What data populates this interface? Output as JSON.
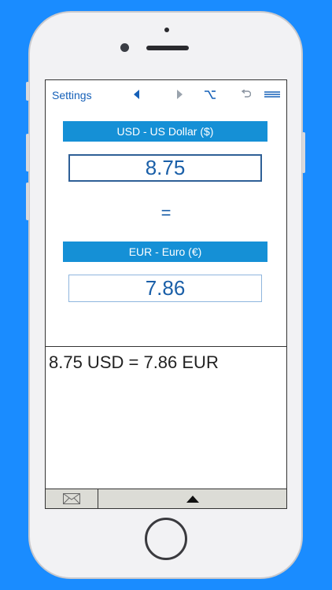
{
  "toolbar": {
    "settings_label": "Settings",
    "icons": [
      "prev-triangle-icon",
      "next-triangle-icon",
      "option-key-icon",
      "undo-icon",
      "menu-icon"
    ]
  },
  "from_currency": {
    "label": "USD - US Dollar ($)",
    "amount": "8.75"
  },
  "equals_sign": "=",
  "to_currency": {
    "label": "EUR - Euro (€)",
    "amount": "7.86"
  },
  "result_text": "8.75 USD = 7.86 EUR",
  "bottom_bar": {
    "icons": [
      "mail-icon",
      "expand-up-icon"
    ]
  },
  "colors": {
    "background": "#1a8cff",
    "label_bar": "#1590d6",
    "accent_text": "#1560b8"
  }
}
